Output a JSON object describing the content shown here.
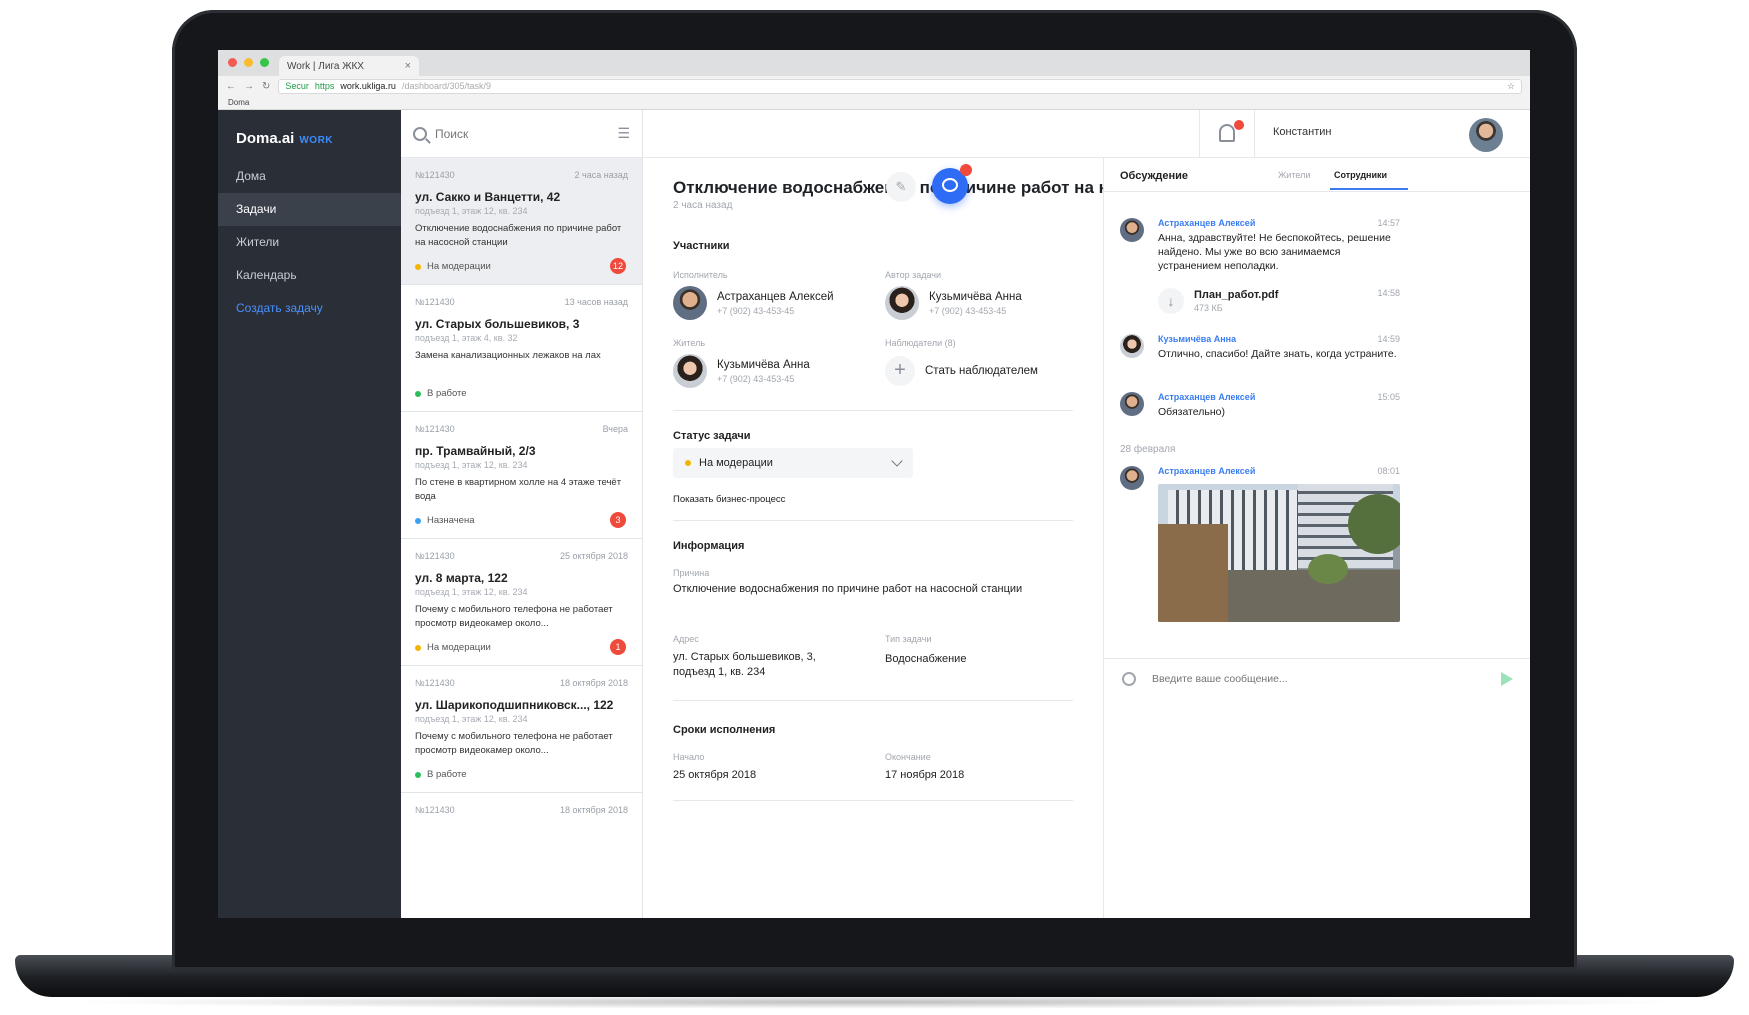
{
  "browser": {
    "tab_title": "Work | Лига ЖКХ",
    "tab_close": "×",
    "url_secure": "Secur",
    "url_scheme": "https",
    "url_domain": "work.ukliga.ru",
    "url_path": "/dashboard/305/task/9",
    "bookmark": "Doma"
  },
  "sidebar": {
    "logo": "Doma.ai",
    "logo_sub": "WORK",
    "items": [
      {
        "label": "Дома"
      },
      {
        "label": "Задачи"
      },
      {
        "label": "Жители"
      },
      {
        "label": "Календарь"
      },
      {
        "label": "Создать задачу"
      }
    ]
  },
  "search": {
    "placeholder": "Поиск"
  },
  "tasks": [
    {
      "id": "№121430",
      "time": "2 часа назад",
      "address": "ул. Сакко и Ванцетти, 42",
      "sub": "подъезд 1, этаж 12, кв. 234",
      "desc": "Отключение водоснабжения по причине работ на насосной станции",
      "status": "На модерации",
      "status_color": "#f5b400",
      "badge": "12"
    },
    {
      "id": "№121430",
      "time": "13 часов назад",
      "address": "ул. Старых большевиков, 3",
      "sub": "подъезд 1, этаж 4, кв. 32",
      "desc": "Замена канализационных лежаков на лах",
      "status": "В работе",
      "status_color": "#2dbd5a",
      "badge": ""
    },
    {
      "id": "№121430",
      "time": "Вчера",
      "address": "пр. Трамвайный, 2/3",
      "sub": "подъезд 1, этаж 12, кв. 234",
      "desc": "По стене в квартирном холле на 4 этаже течёт вода",
      "status": "Назначена",
      "status_color": "#3aa0f0",
      "badge": "3"
    },
    {
      "id": "№121430",
      "time": "25 октября 2018",
      "address": "ул. 8 марта, 122",
      "sub": "подъезд 1, этаж 12, кв. 234",
      "desc": "Почему с мобильного телефона не работает просмотр видеокамер около...",
      "status": "На модерации",
      "status_color": "#f5b400",
      "badge": "1"
    },
    {
      "id": "№121430",
      "time": "18 октября 2018",
      "address": "ул. Шарикоподшипниковск..., 122",
      "sub": "подъезд 1, этаж 12, кв. 234",
      "desc": "Почему с мобильного телефона не работает просмотр видеокамер около...",
      "status": "В работе",
      "status_color": "#2dbd5a",
      "badge": ""
    },
    {
      "id": "№121430",
      "time": "18 октября 2018",
      "address": "",
      "sub": "",
      "desc": "",
      "status": "",
      "status_color": "#ffffff",
      "badge": ""
    }
  ],
  "topbar": {
    "user_name": "Константин"
  },
  "task": {
    "title": "Отключение водоснабжения по причине работ на насосной...",
    "time": "2 часа назад",
    "participants_title": "Участники",
    "executor_label": "Исполнитель",
    "executor_name": "Астраханцев Алексей",
    "executor_phone": "+7 (902) 43-453-45",
    "author_label": "Автор задачи",
    "author_name": "Кузьмичёва Анна",
    "author_phone": "+7 (902) 43-453-45",
    "resident_label": "Житель",
    "resident_name": "Кузьмичёва Анна",
    "resident_phone": "+7 (902) 43-453-45",
    "observers_label": "Наблюдатели (8)",
    "observers_action": "Стать наблюдателем",
    "status_title": "Статус задачи",
    "status_value": "На модерации",
    "status_color": "#f5b400",
    "show_process": "Показать бизнес-процесс",
    "info_title": "Информация",
    "reason_label": "Причина",
    "reason_text": "Отключение водоснабжения по причине работ на насосной станции",
    "address_label": "Адрес",
    "address_line1": "ул. Старых большевиков, 3,",
    "address_line2": "подъезд 1, кв. 234",
    "type_label": "Тип задачи",
    "type_value": "Водоснабжение",
    "deadlines_title": "Сроки исполнения",
    "start_label": "Начало",
    "start_value": "25 октября 2018",
    "end_label": "Окончание",
    "end_value": "17 ноября 2018"
  },
  "discussion": {
    "title": "Обсуждение",
    "tab_residents": "Жители",
    "tab_staff": "Сотрудники",
    "messages": [
      {
        "author": "Астраханцев Алексей",
        "time": "14:57",
        "text": "Анна, здравствуйте! Не беспокойтесь, решение найдено. Мы уже во всю занимаемся устранением неполадки."
      },
      {
        "author": "Кузьмичёва Анна",
        "time": "14:59",
        "text": "Отлично, спасибо! Дайте знать, когда устраните."
      },
      {
        "author": "Астраханцев Алексей",
        "time": "15:05",
        "text": "Обязательно)"
      },
      {
        "author": "Астраханцев Алексей",
        "time": "08:01",
        "text": ""
      }
    ],
    "file": {
      "name": "План_работ.pdf",
      "size": "473 КБ",
      "time": "14:58"
    },
    "date_separator": "28 февраля",
    "composer_placeholder": "Введите ваше сообщение..."
  }
}
